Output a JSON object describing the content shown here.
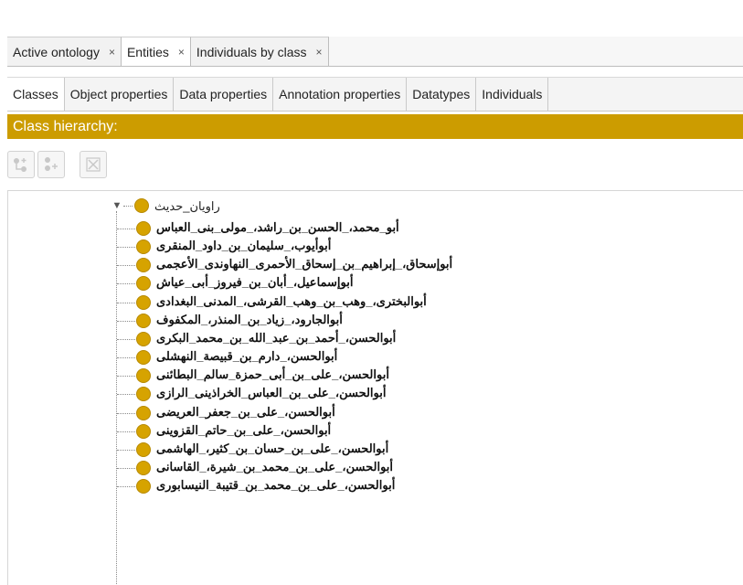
{
  "top_tabs": [
    {
      "label": "Active ontology",
      "close": "×"
    },
    {
      "label": "Entities",
      "close": "×"
    },
    {
      "label": "Individuals by class",
      "close": "×"
    }
  ],
  "sub_tabs": [
    "Classes",
    "Object properties",
    "Data properties",
    "Annotation properties",
    "Datatypes",
    "Individuals"
  ],
  "hierarchy": {
    "title": "Class hierarchy:",
    "header_color": "#cc9c00",
    "toolbar_icons": [
      "add-subclass-icon",
      "add-sibling-icon",
      "delete-class-icon"
    ],
    "root": "راويان_حديث",
    "class_color": "#d6a300",
    "children": [
      "أبو_محمد،_الحسن_بن_راشد،_مولى_بنى_العباس",
      "أبوأيوب،_سليمان_بن_داود_المنقرى",
      "أبوإسحاق،_إبراهيم_بن_إسحاق_الأحمرى_النهاوندى_الأعجمى",
      "أبوإسماعيل،_أبان_بن_فيروز_أبى_عياش",
      "أبوالبخترى،_وهب_بن_وهب_القرشى،_المدنى_البغدادى",
      "أبوالجارود،_زياد_بن_المنذر،_المكفوف",
      "أبوالحسن،_أحمد_بن_عبد_الله_بن_محمد_البكرى",
      "أبوالحسن،_دارم_بن_قبيصة_النهشلى",
      "أبوالحسن،_على_بن_أبى_حمزة_سالم_البطائنى",
      "أبوالحسن،_على_بن_العباس_الخراذينى_الرازى",
      "أبوالحسن،_على_بن_جعفر_العريضى",
      "أبوالحسن،_على_بن_حاتم_القزوينى",
      "أبوالحسن،_على_بن_حسان_بن_كثير،_الهاشمى",
      "أبوالحسن،_على_بن_محمد_بن_شيرة،_القاسانى",
      "أبوالحسن،_على_بن_محمد_بن_قتيبة_النيسابورى"
    ]
  }
}
